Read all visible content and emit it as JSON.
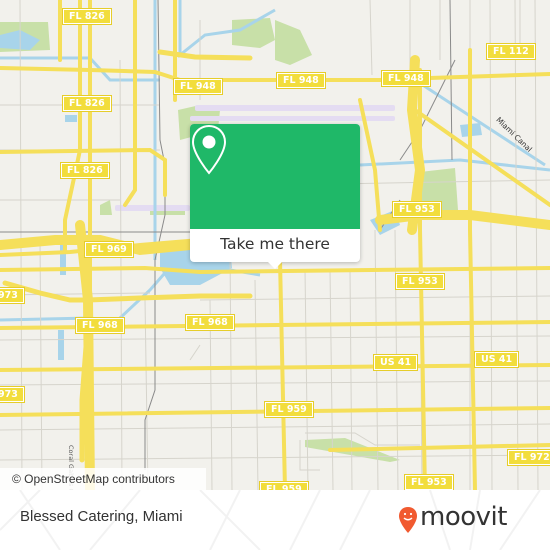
{
  "map": {
    "road_labels": [
      {
        "id": "fl826-a",
        "text": "FL 826"
      },
      {
        "id": "fl826-b",
        "text": "FL 826"
      },
      {
        "id": "fl826-c",
        "text": "FL 826"
      },
      {
        "id": "fl948-a",
        "text": "FL 948"
      },
      {
        "id": "fl948-b",
        "text": "FL 948"
      },
      {
        "id": "fl948-c",
        "text": "FL 948"
      },
      {
        "id": "fl112",
        "text": "FL 112"
      },
      {
        "id": "fl969",
        "text": "FL 969"
      },
      {
        "id": "fl953-a",
        "text": "FL 953"
      },
      {
        "id": "fl953-b",
        "text": "FL 953"
      },
      {
        "id": "fl953-c",
        "text": "FL 953"
      },
      {
        "id": "fl973-a",
        "text": "973"
      },
      {
        "id": "fl973-b",
        "text": "973"
      },
      {
        "id": "fl968-a",
        "text": "FL 968"
      },
      {
        "id": "fl968-b",
        "text": "FL 968"
      },
      {
        "id": "us41-a",
        "text": "US 41"
      },
      {
        "id": "us41-b",
        "text": "US 41"
      },
      {
        "id": "fl959-a",
        "text": "FL 959"
      },
      {
        "id": "fl959-b",
        "text": "FL 959"
      },
      {
        "id": "fl972",
        "text": "FL 972"
      }
    ],
    "canal_label": "Miami Canal",
    "street_label": "Coral Gables Canal",
    "attribution": "© OpenStreetMap contributors",
    "colors": {
      "land": "#f2f1ec",
      "road": "#f5df5a",
      "water": "#a8d4ea",
      "park": "#c8e0a8",
      "runway": "#e4dcf2",
      "minor_road": "#cfcdc6",
      "rail": "#888888"
    }
  },
  "popup": {
    "button_label": "Take me there",
    "icon": "map-pin-icon",
    "color": "#1fb868"
  },
  "footer": {
    "place_name": "Blessed Catering, Miami",
    "brand": "moovit",
    "brand_color": "#f15a30"
  }
}
